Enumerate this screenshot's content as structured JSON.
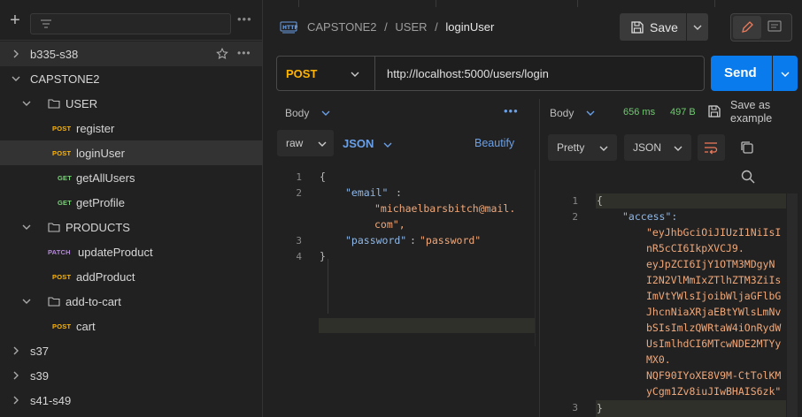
{
  "sidebar": {
    "plus": "+",
    "more": "•••",
    "items": [
      {
        "label": "b335-s38",
        "kind": "collection",
        "expanded": false
      },
      {
        "label": "CAPSTONE2",
        "kind": "collection",
        "expanded": true
      },
      {
        "label": "USER",
        "kind": "folder",
        "expanded": true
      },
      {
        "method": "POST",
        "label": "register",
        "kind": "request"
      },
      {
        "method": "POST",
        "label": "loginUser",
        "kind": "request",
        "selected": true
      },
      {
        "method": "GET",
        "label": "getAllUsers",
        "kind": "request"
      },
      {
        "method": "GET",
        "label": "getProfile",
        "kind": "request"
      },
      {
        "label": "PRODUCTS",
        "kind": "folder",
        "expanded": true
      },
      {
        "method": "PATCH",
        "label": "updateProduct",
        "kind": "request"
      },
      {
        "method": "POST",
        "label": "addProduct",
        "kind": "request"
      },
      {
        "label": "add-to-cart",
        "kind": "folder",
        "expanded": true
      },
      {
        "method": "POST",
        "label": "cart",
        "kind": "request"
      },
      {
        "label": "s37",
        "kind": "collection",
        "expanded": false
      },
      {
        "label": "s39",
        "kind": "collection",
        "expanded": false
      },
      {
        "label": "s41-s49",
        "kind": "collection",
        "expanded": false
      }
    ]
  },
  "header": {
    "breadcrumb": [
      "CAPSTONE2",
      "USER",
      "loginUser"
    ],
    "separator": "/",
    "save_label": "Save"
  },
  "request": {
    "method": "POST",
    "url": "http://localhost:5000/users/login",
    "send_label": "Send",
    "body_tab": "Body",
    "more": "•••",
    "mode": "raw",
    "format": "JSON",
    "beautify": "Beautify",
    "lines": [
      "1",
      "2",
      "3",
      "4"
    ],
    "brace_open": "{",
    "brace_close": "}",
    "email_key": "\"email\"",
    "email_value_1": "\"michaelbarsbitch@mail.",
    "email_value_2": "com\",",
    "password_key": "\"password\"",
    "password_value": "\"password\"",
    "colon": ":"
  },
  "response": {
    "body_tab": "Body",
    "time": "656 ms",
    "size": "497 B",
    "save_as_example": "Save as example",
    "view": "Pretty",
    "format": "JSON",
    "lines": [
      "1",
      "2",
      "3"
    ],
    "brace_open": "{",
    "brace_close": "}",
    "access_key": "\"access\":",
    "token_lines": [
      "\"eyJhbGciOiJIUzI1NiIsI",
      "nR5cCI6IkpXVCJ9.",
      "eyJpZCI6IjY1OTM3MDgyN",
      "I2N2VlMmIxZTlhZTM3ZiIs",
      "ImVtYWlsIjoibWljaGFlbG",
      "JhcnNiaXRjaEBtYWlsLmNv",
      "bSIsImlzQWRtaW4iOnRydW",
      "UsImlhdCI6MTcwNDE2MTYy",
      "MX0.",
      "NQF90IYoXE8V9M-CtTolKM",
      "yCgm1Zv8iuJIwBHAIS6zk\""
    ]
  },
  "colors": {
    "post": "#ffb400",
    "get": "#7bd37b",
    "patch": "#b48ad8",
    "send": "#097bed",
    "accent": "#6aa0e8"
  }
}
